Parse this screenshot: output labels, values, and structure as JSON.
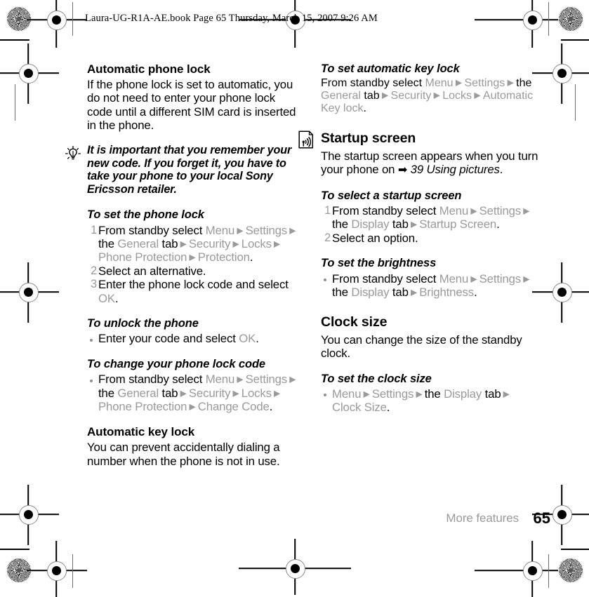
{
  "header": {
    "slug": "Laura-UG-R1A-AE.book  Page 65  Thursday, March 15, 2007  9:26 AM"
  },
  "colors": {
    "ui_path_gray": "#9a9a9a",
    "body_black": "#000000",
    "footer_gray": "#9a9a9a"
  },
  "left_column": {
    "automatic_phone_lock": {
      "heading": "Automatic phone lock",
      "body": "If the phone lock is set to automatic, you do not need to enter your phone lock code until a different SIM card is inserted in the phone."
    },
    "tip": {
      "icon": "tip-lightbulb-icon",
      "text": "It is important that you remember your new code. If you forget it, you have to take your phone to your local Sony Ericsson retailer."
    },
    "to_set_the_phone_lock": {
      "heading": "To set the phone lock",
      "steps": [
        {
          "num": "1",
          "parts": [
            {
              "t": "From standby select ",
              "s": "plain"
            },
            {
              "t": "Menu",
              "s": "ui"
            },
            {
              "t": " ▶ ",
              "s": "arrow"
            },
            {
              "t": "Settings",
              "s": "ui"
            },
            {
              "t": " ▶ ",
              "s": "arrow"
            },
            {
              "t": "the ",
              "s": "plain"
            },
            {
              "t": "General",
              "s": "ui"
            },
            {
              "t": " tab",
              "s": "plain"
            },
            {
              "t": " ▶ ",
              "s": "arrow"
            },
            {
              "t": "Security",
              "s": "ui"
            },
            {
              "t": " ▶ ",
              "s": "arrow"
            },
            {
              "t": "Locks",
              "s": "ui"
            },
            {
              "t": " ▶ ",
              "s": "arrow"
            },
            {
              "t": "Phone Protection",
              "s": "ui"
            },
            {
              "t": " ▶ ",
              "s": "arrow"
            },
            {
              "t": "Protection",
              "s": "ui"
            },
            {
              "t": ".",
              "s": "plain"
            }
          ]
        },
        {
          "num": "2",
          "parts": [
            {
              "t": "Select an alternative.",
              "s": "plain"
            }
          ]
        },
        {
          "num": "3",
          "parts": [
            {
              "t": "Enter the phone lock code and select ",
              "s": "plain"
            },
            {
              "t": "OK",
              "s": "ui"
            },
            {
              "t": ".",
              "s": "plain"
            }
          ]
        }
      ]
    },
    "to_unlock_the_phone": {
      "heading": "To unlock the phone",
      "steps": [
        {
          "bullet": true,
          "parts": [
            {
              "t": "Enter your code and select ",
              "s": "plain"
            },
            {
              "t": "OK",
              "s": "ui"
            },
            {
              "t": ".",
              "s": "plain"
            }
          ]
        }
      ]
    },
    "to_change_your_phone_lock_code": {
      "heading": "To change your phone lock code",
      "steps": [
        {
          "bullet": true,
          "parts": [
            {
              "t": "From standby select ",
              "s": "plain"
            },
            {
              "t": "Menu",
              "s": "ui"
            },
            {
              "t": " ▶ ",
              "s": "arrow"
            },
            {
              "t": "Settings",
              "s": "ui"
            },
            {
              "t": " ▶ ",
              "s": "arrow"
            },
            {
              "t": "the ",
              "s": "plain"
            },
            {
              "t": "General",
              "s": "ui"
            },
            {
              "t": " tab",
              "s": "plain"
            },
            {
              "t": " ▶ ",
              "s": "arrow"
            },
            {
              "t": "Security",
              "s": "ui"
            },
            {
              "t": " ▶ ",
              "s": "arrow"
            },
            {
              "t": "Locks",
              "s": "ui"
            },
            {
              "t": " ▶ ",
              "s": "arrow"
            },
            {
              "t": "Phone Protection",
              "s": "ui"
            },
            {
              "t": " ▶ ",
              "s": "arrow"
            },
            {
              "t": "Change Code",
              "s": "ui"
            },
            {
              "t": ".",
              "s": "plain"
            }
          ]
        }
      ]
    },
    "automatic_key_lock": {
      "heading": "Automatic key lock",
      "body": "You can prevent accidentally dialing a number when the phone is not in use."
    }
  },
  "right_column": {
    "to_set_automatic_key_lock": {
      "heading": "To set automatic key lock",
      "steps": [
        {
          "bullet": false,
          "parts": [
            {
              "t": "From standby select ",
              "s": "plain"
            },
            {
              "t": "Menu",
              "s": "ui"
            },
            {
              "t": " ▶ ",
              "s": "arrow"
            },
            {
              "t": "Settings",
              "s": "ui"
            },
            {
              "t": " ▶ ",
              "s": "arrow"
            },
            {
              "t": "the ",
              "s": "plain"
            },
            {
              "t": "General",
              "s": "ui"
            },
            {
              "t": " tab",
              "s": "plain"
            },
            {
              "t": " ▶ ",
              "s": "arrow"
            },
            {
              "t": "Security",
              "s": "ui"
            },
            {
              "t": " ▶ ",
              "s": "arrow"
            },
            {
              "t": "Locks",
              "s": "ui"
            },
            {
              "t": " ▶ ",
              "s": "arrow"
            },
            {
              "t": "Automatic Key lock",
              "s": "ui"
            },
            {
              "t": ".",
              "s": "plain"
            }
          ]
        }
      ]
    },
    "startup_screen": {
      "heading": "Startup screen",
      "icon": "note-signal-icon",
      "body_parts": [
        {
          "t": "The startup screen appears when you turn your phone on ",
          "s": "plain"
        },
        {
          "t": "➡",
          "s": "solid-arrow"
        },
        {
          "t": " 39 Using pictures",
          "s": "italic"
        },
        {
          "t": ".",
          "s": "plain"
        }
      ]
    },
    "to_select_a_startup_screen": {
      "heading": "To select a startup screen",
      "steps": [
        {
          "num": "1",
          "parts": [
            {
              "t": "From standby select ",
              "s": "plain"
            },
            {
              "t": "Menu",
              "s": "ui"
            },
            {
              "t": " ▶ ",
              "s": "arrow"
            },
            {
              "t": "Settings",
              "s": "ui"
            },
            {
              "t": " ▶ ",
              "s": "arrow"
            },
            {
              "t": "the ",
              "s": "plain"
            },
            {
              "t": "Display",
              "s": "ui"
            },
            {
              "t": " tab",
              "s": "plain"
            },
            {
              "t": " ▶ ",
              "s": "arrow"
            },
            {
              "t": "Startup Screen",
              "s": "ui"
            },
            {
              "t": ".",
              "s": "plain"
            }
          ]
        },
        {
          "num": "2",
          "parts": [
            {
              "t": "Select an option.",
              "s": "plain"
            }
          ]
        }
      ]
    },
    "to_set_the_brightness": {
      "heading": "To set the brightness",
      "steps": [
        {
          "bullet": true,
          "parts": [
            {
              "t": "From standby select ",
              "s": "plain"
            },
            {
              "t": "Menu",
              "s": "ui"
            },
            {
              "t": " ▶ ",
              "s": "arrow"
            },
            {
              "t": "Settings",
              "s": "ui"
            },
            {
              "t": " ▶ ",
              "s": "arrow"
            },
            {
              "t": "the ",
              "s": "plain"
            },
            {
              "t": "Display",
              "s": "ui"
            },
            {
              "t": " tab",
              "s": "plain"
            },
            {
              "t": " ▶ ",
              "s": "arrow"
            },
            {
              "t": "Brightness",
              "s": "ui"
            },
            {
              "t": ".",
              "s": "plain"
            }
          ]
        }
      ]
    },
    "clock_size": {
      "heading": "Clock size",
      "body": "You can change the size of the standby clock."
    },
    "to_set_the_clock_size": {
      "heading": "To set the clock size",
      "steps": [
        {
          "bullet": true,
          "parts": [
            {
              "t": "Menu",
              "s": "ui"
            },
            {
              "t": " ▶ ",
              "s": "arrow"
            },
            {
              "t": "Settings",
              "s": "ui"
            },
            {
              "t": " ▶ ",
              "s": "arrow"
            },
            {
              "t": "the ",
              "s": "plain"
            },
            {
              "t": "Display",
              "s": "ui"
            },
            {
              "t": " tab",
              "s": "plain"
            },
            {
              "t": " ▶ ",
              "s": "arrow"
            },
            {
              "t": "Clock Size",
              "s": "ui"
            },
            {
              "t": ".",
              "s": "plain"
            }
          ]
        }
      ]
    }
  },
  "footer": {
    "chapter": "More features",
    "page_number": "65"
  }
}
